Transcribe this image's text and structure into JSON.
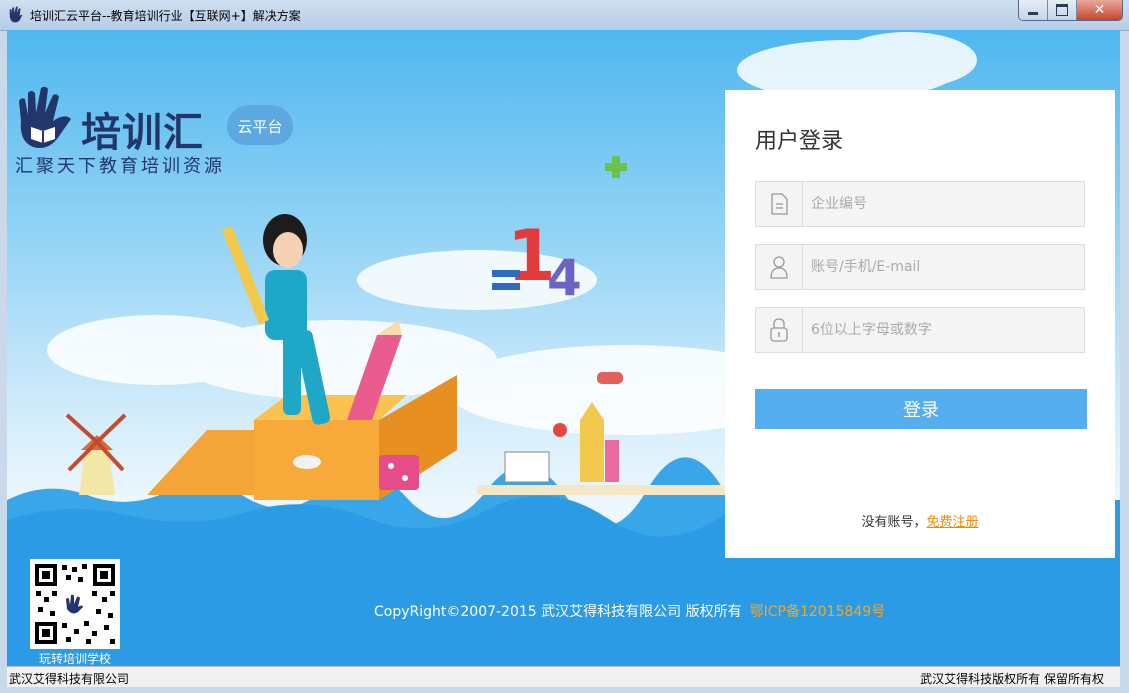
{
  "window": {
    "title": "培训汇云平台--教育培训行业【互联网+】解决方案",
    "close_symbol": "✕"
  },
  "logo": {
    "brand": "培训汇",
    "badge": "云平台",
    "slogan": "汇聚天下教育培训资源"
  },
  "login": {
    "title": "用户登录",
    "company_placeholder": "企业编号",
    "account_placeholder": "账号/手机/E-mail",
    "password_placeholder": "6位以上字母或数字",
    "submit_label": "登录",
    "no_account_text": "没有账号，",
    "register_link": "免费注册"
  },
  "footer": {
    "copyright": "CopyRight©2007-2015 武汉艾得科技有限公司  版权所有",
    "icp": "鄂ICP备12015849号",
    "qr_label": "玩转培训学校"
  },
  "statusbar": {
    "left": "武汉艾得科技有限公司",
    "right": "武汉艾得科技版权所有 保留所有权"
  },
  "colors": {
    "accent": "#55aef0",
    "brand_navy": "#22366b",
    "sea_blue": "#2c9be6",
    "link_orange": "#f08a00"
  }
}
